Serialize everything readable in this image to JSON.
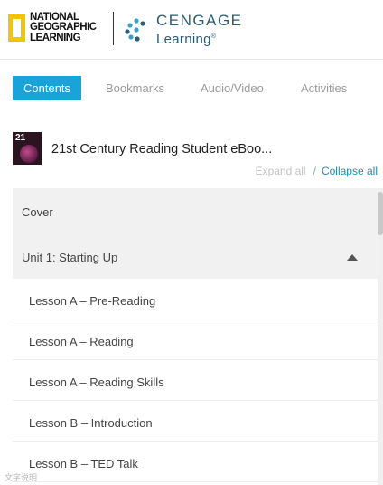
{
  "header": {
    "ng_logo_lines": [
      "NATIONAL",
      "GEOGRAPHIC",
      "LEARNING"
    ],
    "cengage_top": "CENGAGE",
    "cengage_bottom": "Learning",
    "trademark": "®"
  },
  "tabs": [
    {
      "label": "Contents",
      "active": true
    },
    {
      "label": "Bookmarks",
      "active": false
    },
    {
      "label": "Audio/Video",
      "active": false
    },
    {
      "label": "Activities",
      "active": false
    }
  ],
  "book": {
    "cover_number": "21",
    "title": "21st Century Reading Student eBoo..."
  },
  "controls": {
    "expand_all": "Expand all",
    "separator": "/",
    "collapse_all": "Collapse all"
  },
  "toc": {
    "cover": "Cover",
    "unit": "Unit 1: Starting Up",
    "lessons": [
      "Lesson A – Pre-Reading",
      "Lesson A – Reading",
      "Lesson A – Reading Skills",
      "Lesson B – Introduction",
      "Lesson B – TED Talk"
    ]
  },
  "watermark": "文字说明"
}
